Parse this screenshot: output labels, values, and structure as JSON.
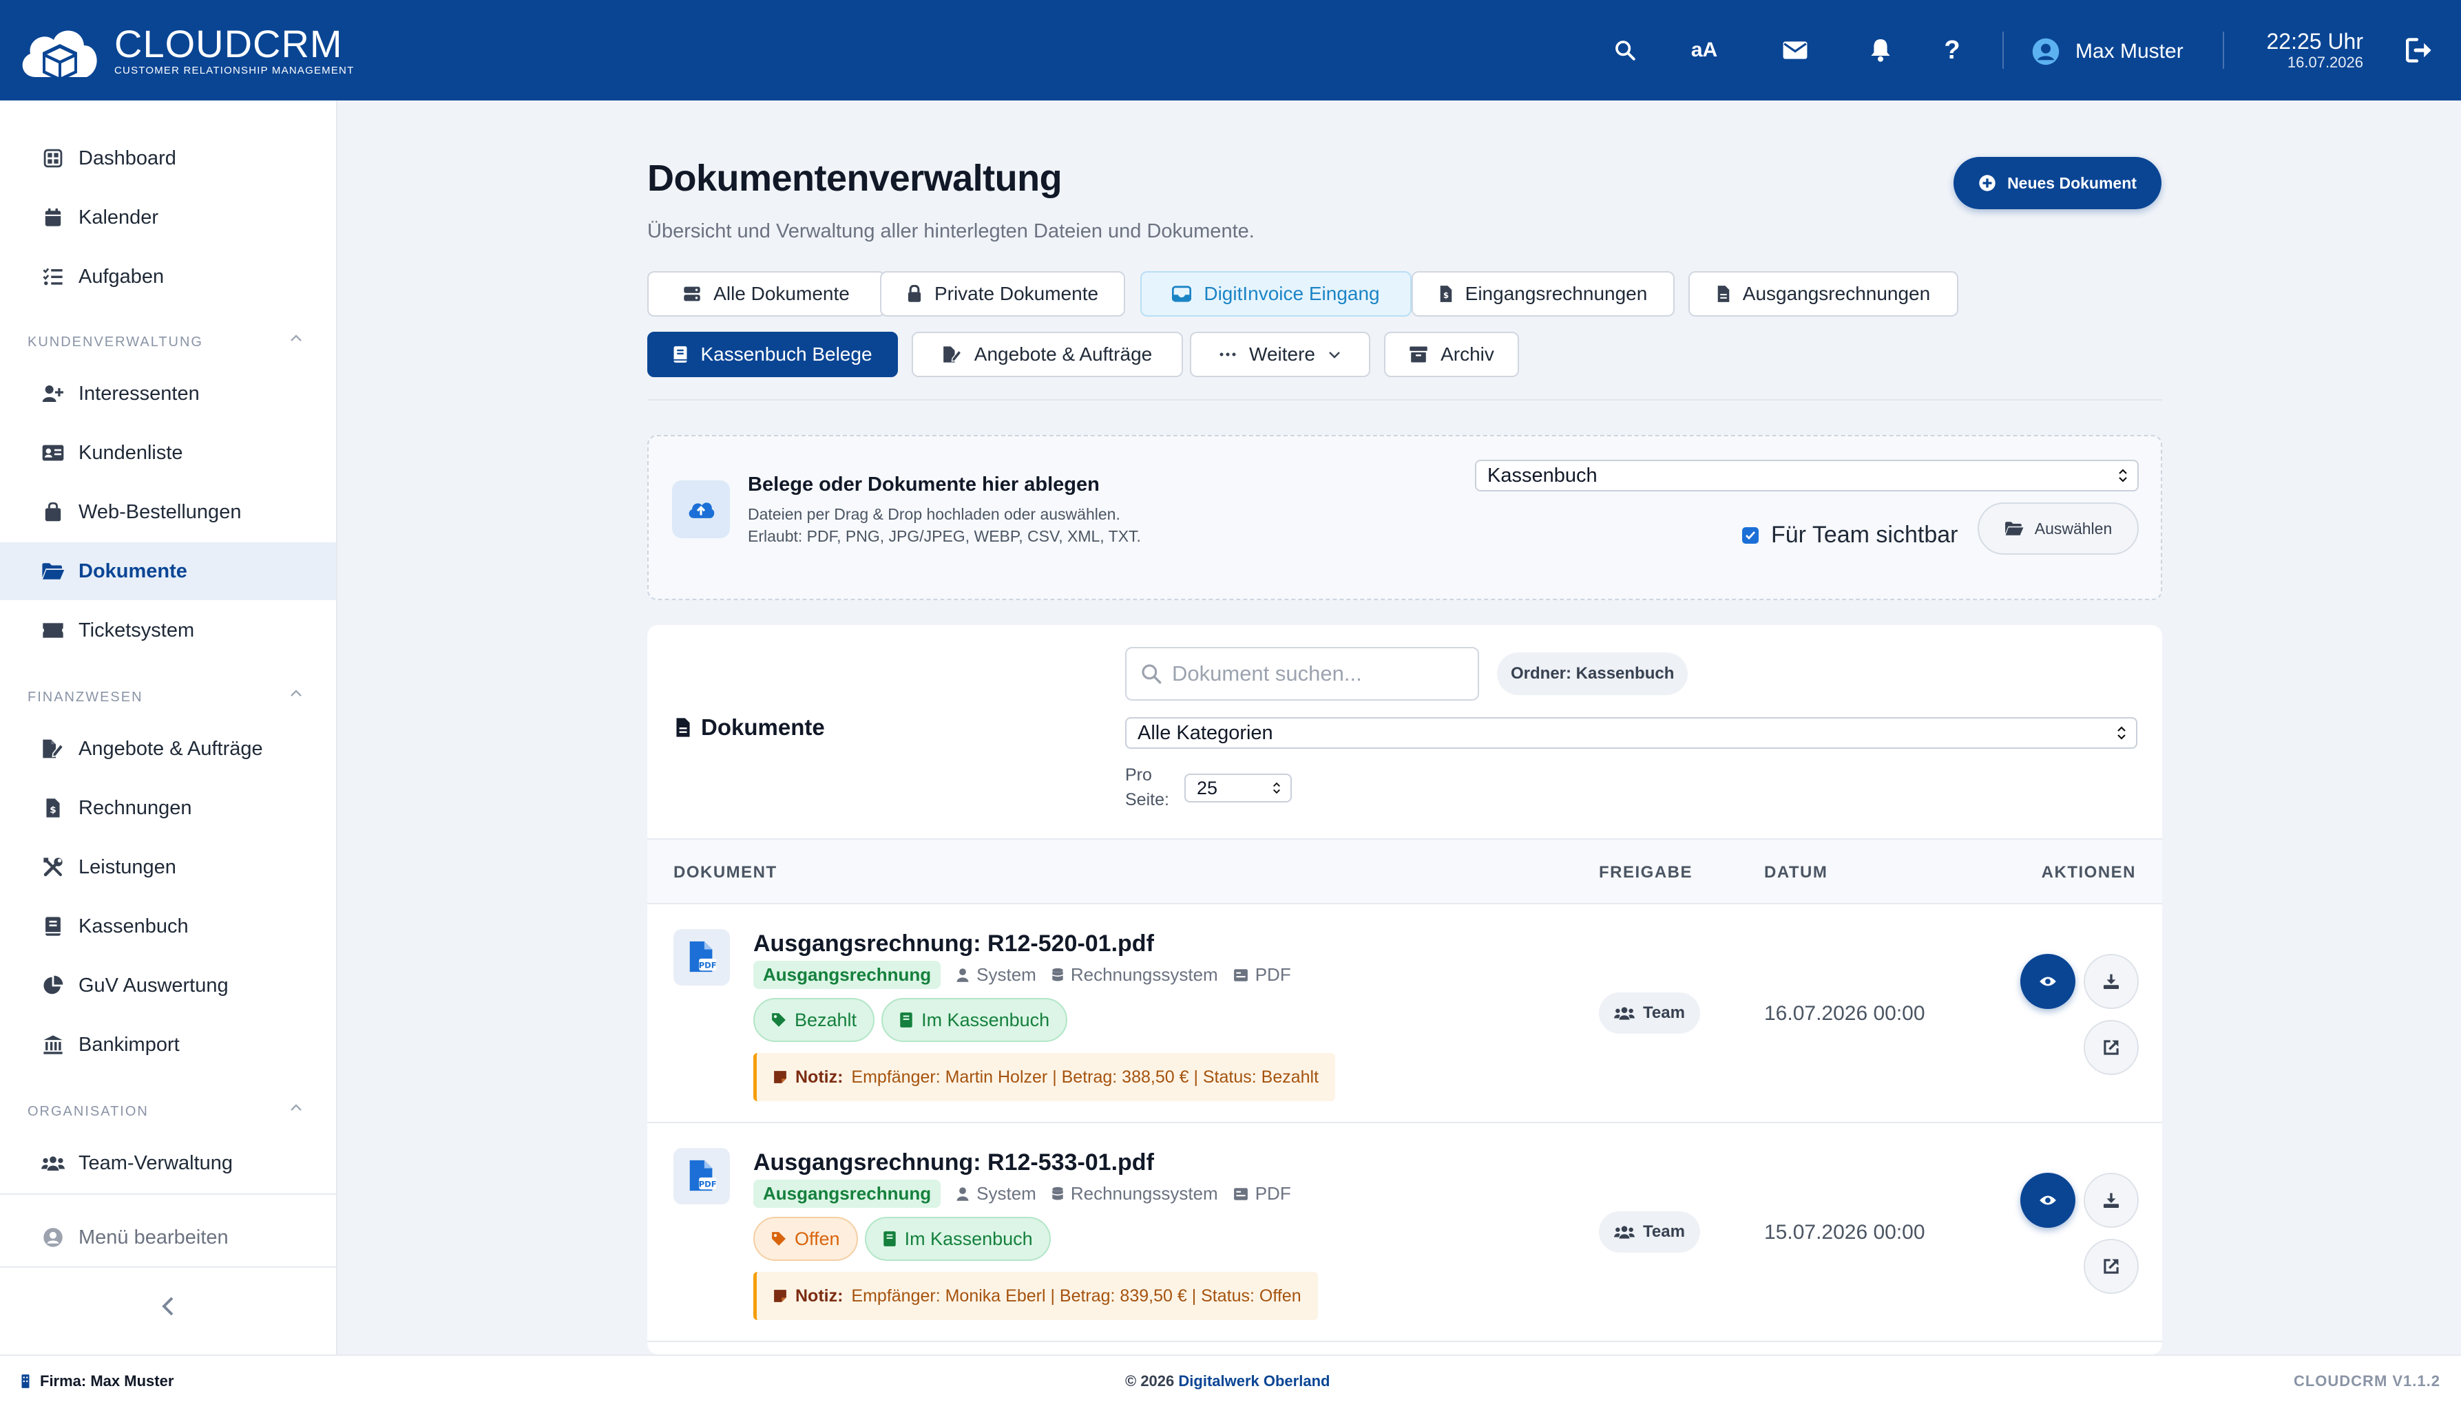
{
  "header": {
    "logo_title": "CLOUDCRM",
    "logo_subtitle": "CUSTOMER RELATIONSHIP MANAGEMENT",
    "font_size_label": "aA",
    "user_name": "Max Muster",
    "time": "22:25 Uhr",
    "date": "16.07.2026"
  },
  "sidebar": {
    "top_items": [
      {
        "label": "Dashboard",
        "icon": "dashboard-icon"
      },
      {
        "label": "Kalender",
        "icon": "calendar-icon"
      },
      {
        "label": "Aufgaben",
        "icon": "tasks-icon"
      }
    ],
    "sections": [
      {
        "title": "KUNDENVERWALTUNG",
        "items": [
          {
            "label": "Interessenten",
            "icon": "user-plus-icon"
          },
          {
            "label": "Kundenliste",
            "icon": "address-card-icon"
          },
          {
            "label": "Web-Bestellungen",
            "icon": "shopping-bag-icon"
          },
          {
            "label": "Dokumente",
            "icon": "folder-open-icon",
            "active": true
          },
          {
            "label": "Ticketsystem",
            "icon": "ticket-icon"
          }
        ]
      },
      {
        "title": "FINANZWESEN",
        "items": [
          {
            "label": "Angebote & Aufträge",
            "icon": "file-signature-icon"
          },
          {
            "label": "Rechnungen",
            "icon": "invoice-icon"
          },
          {
            "label": "Leistungen",
            "icon": "tools-icon"
          },
          {
            "label": "Kassenbuch",
            "icon": "book-icon"
          },
          {
            "label": "GuV Auswertung",
            "icon": "pie-chart-icon"
          },
          {
            "label": "Bankimport",
            "icon": "bank-icon"
          }
        ]
      },
      {
        "title": "ORGANISATION",
        "items": [
          {
            "label": "Team-Verwaltung",
            "icon": "users-icon"
          }
        ]
      }
    ],
    "edit_menu_label": "Menü bearbeiten"
  },
  "main": {
    "title": "Dokumentenverwaltung",
    "subtitle": "Übersicht und Verwaltung aller hinterlegten Dateien und Dokumente.",
    "new_button": "Neues Dokument",
    "tabs": [
      {
        "label": "Alle Dokumente"
      },
      {
        "label": "Private Dokumente"
      },
      {
        "label": "DigitInvoice Eingang"
      },
      {
        "label": "Eingangsrechnungen"
      },
      {
        "label": "Ausgangsrechnungen"
      },
      {
        "label": "Kassenbuch Belege",
        "active": true
      },
      {
        "label": "Angebote & Aufträge"
      },
      {
        "label": "Weitere"
      },
      {
        "label": "Archiv"
      }
    ],
    "upload": {
      "title": "Belege oder Dokumente hier ablegen",
      "line1": "Dateien per Drag & Drop hochladen oder auswählen.",
      "line2": "Erlaubt: PDF, PNG, JPG/JPEG, WEBP, CSV, XML, TXT.",
      "folder_select": "Kassenbuch",
      "team_visible_label": "Für Team sichtbar",
      "team_visible_checked": true,
      "select_button": "Auswählen"
    },
    "documents": {
      "title": "Dokumente",
      "search_placeholder": "Dokument suchen...",
      "folder_badge": "Ordner: Kassenbuch",
      "category_select": "Alle Kategorien",
      "per_page_label": "Pro Seite:",
      "per_page_value": "25",
      "columns": [
        "DOKUMENT",
        "FREIGABE",
        "DATUM",
        "AKTIONEN"
      ],
      "rows": [
        {
          "name": "Ausgangsrechnung: R12-520-01.pdf",
          "type": "Ausgangsrechnung",
          "creator": "System",
          "source": "Rechnungssystem",
          "format": "PDF",
          "status": "Bezahlt",
          "status_kind": "paid",
          "cashbook": "Im Kassenbuch",
          "note_label": "Notiz:",
          "note": "Empfänger: Martin Holzer | Betrag: 388,50 € | Status: Bezahlt",
          "share": "Team",
          "date": "16.07.2026 00:00"
        },
        {
          "name": "Ausgangsrechnung: R12-533-01.pdf",
          "type": "Ausgangsrechnung",
          "creator": "System",
          "source": "Rechnungssystem",
          "format": "PDF",
          "status": "Offen",
          "status_kind": "open",
          "cashbook": "Im Kassenbuch",
          "note_label": "Notiz:",
          "note": "Empfänger: Monika Eberl | Betrag: 839,50 € | Status: Offen",
          "share": "Team",
          "date": "15.07.2026 00:00"
        }
      ]
    }
  },
  "footer": {
    "company": "Firma: Max Muster",
    "copyright": "© 2026 ",
    "company_link": "Digitalwerk Oberland",
    "version": "CLOUDCRM V1.1.2"
  },
  "colors": {
    "primary": "#0a4594",
    "page_bg": "#f0f3f8",
    "success": "#15803d",
    "warning": "#d9640c",
    "info": "#1b84c5"
  }
}
